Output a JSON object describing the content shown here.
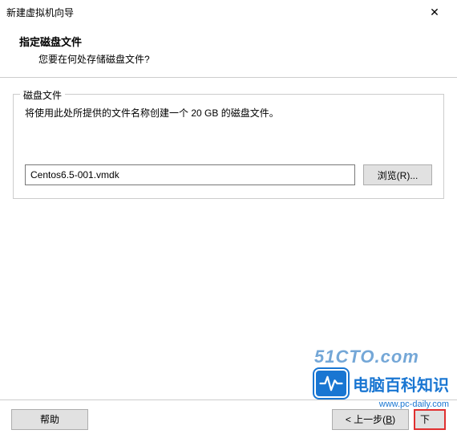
{
  "window": {
    "title": "新建虚拟机向导",
    "close_symbol": "✕"
  },
  "header": {
    "title": "指定磁盘文件",
    "subtitle": "您要在何处存储磁盘文件?"
  },
  "group": {
    "label": "磁盘文件",
    "description": "将使用此处所提供的文件名称创建一个 20 GB 的磁盘文件。"
  },
  "file": {
    "value": "Centos6.5-001.vmdk"
  },
  "buttons": {
    "browse": "浏览(R)...",
    "help": "帮助",
    "back": "< 上一步(B)",
    "next": "下",
    "cancel": ""
  },
  "watermark": {
    "line1": "51CTO.com",
    "brand": "电脑百科知识",
    "url": "www.pc-daily.com"
  }
}
